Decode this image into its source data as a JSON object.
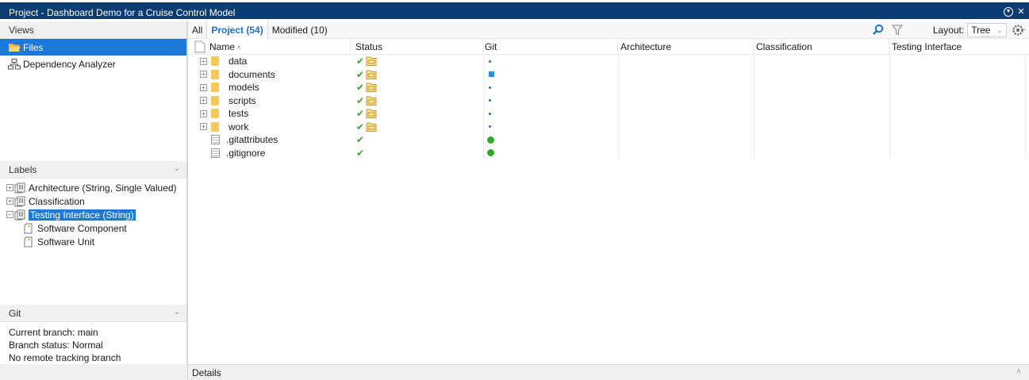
{
  "window": {
    "title": "Project - Dashboard Demo for a Cruise Control Model"
  },
  "views": {
    "header": "Views",
    "items": [
      {
        "label": "Files",
        "icon": "folder-open-icon",
        "selected": true
      },
      {
        "label": "Dependency Analyzer",
        "icon": "dependency-icon",
        "selected": false
      }
    ]
  },
  "labels": {
    "header": "Labels",
    "items": [
      {
        "label": "Architecture (String, Single Valued)",
        "expander": "+",
        "selected": false
      },
      {
        "label": "Classification",
        "expander": "+",
        "selected": false
      },
      {
        "label": "Testing Interface (String)",
        "expander": "−",
        "selected": true
      }
    ],
    "children": [
      {
        "label": "Software Component"
      },
      {
        "label": "Software Unit"
      }
    ]
  },
  "git": {
    "header": "Git",
    "lines": [
      "Current branch: main",
      "Branch status: Normal",
      "No remote tracking branch"
    ]
  },
  "tabs": [
    {
      "label": "All",
      "active": false
    },
    {
      "label": "Project (54)",
      "active": true
    },
    {
      "label": "Modified (10)",
      "active": false
    }
  ],
  "toolbar": {
    "layout_label": "Layout:",
    "layout_value": "Tree"
  },
  "table": {
    "columns": [
      "Name",
      "Status",
      "Git",
      "Architecture",
      "Classification",
      "Testing Interface"
    ],
    "rows": [
      {
        "name": "data",
        "type": "folder",
        "git": "dot"
      },
      {
        "name": "documents",
        "type": "folder",
        "git": "square"
      },
      {
        "name": "models",
        "type": "folder",
        "git": "dot"
      },
      {
        "name": "scripts",
        "type": "folder",
        "git": "dot"
      },
      {
        "name": "tests",
        "type": "folder",
        "git": "dot"
      },
      {
        "name": "work",
        "type": "folder",
        "git": "dot"
      },
      {
        "name": ".gitattributes",
        "type": "file",
        "git": "green"
      },
      {
        "name": ".gitignore",
        "type": "file",
        "git": "green"
      }
    ]
  },
  "details": {
    "label": "Details"
  },
  "colors": {
    "titlebar": "#0b3c72",
    "selection": "#1e78d7",
    "accent": "#1e6fd0",
    "check": "#3aa52c",
    "folder": "#f6c85a"
  }
}
